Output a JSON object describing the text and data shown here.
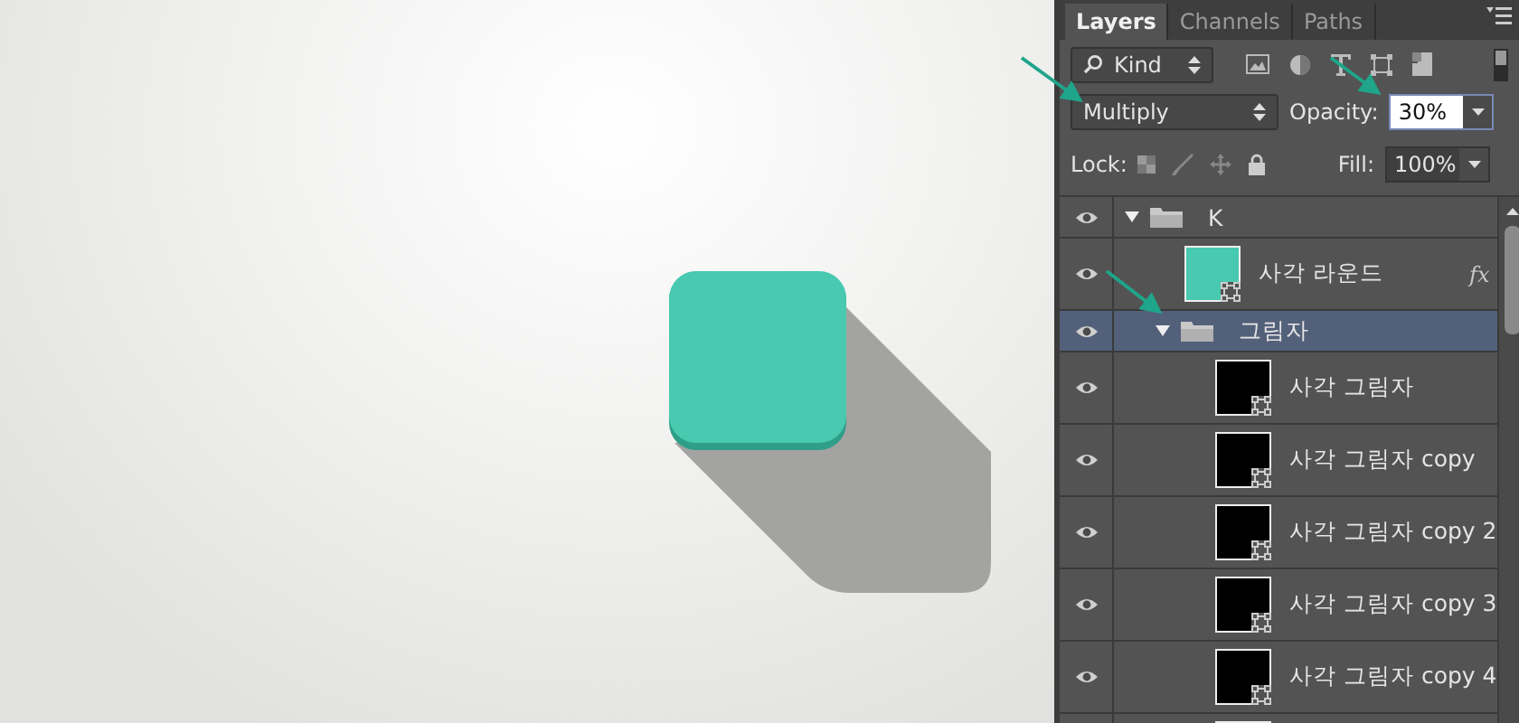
{
  "panel": {
    "tabs": [
      {
        "label": "Layers",
        "selected": true
      },
      {
        "label": "Channels",
        "selected": false
      },
      {
        "label": "Paths",
        "selected": false
      }
    ],
    "filter": {
      "value": "Kind"
    },
    "blend_mode": {
      "value": "Multiply"
    },
    "opacity": {
      "label": "Opacity:",
      "value": "30%"
    },
    "lock": {
      "label": "Lock:"
    },
    "fill": {
      "label": "Fill:",
      "value": "100%"
    },
    "layers": [
      {
        "name": "K",
        "kind": "group",
        "expanded": true,
        "selected": false,
        "visible": true,
        "children": [
          {
            "name": "사각 라운드",
            "kind": "shape",
            "color": "#48c9b0",
            "effects": "fx",
            "selected": false,
            "visible": true
          },
          {
            "name": "그림자",
            "kind": "group",
            "expanded": true,
            "selected": true,
            "visible": true,
            "children": [
              {
                "name": "사각 그림자",
                "kind": "shape",
                "color": "#000000",
                "selected": false,
                "visible": true
              },
              {
                "name": "사각 그림자 copy",
                "kind": "shape",
                "color": "#000000",
                "selected": false,
                "visible": true
              },
              {
                "name": "사각 그림자 copy 2",
                "kind": "shape",
                "color": "#000000",
                "selected": false,
                "visible": true
              },
              {
                "name": "사각 그림자 copy 3",
                "kind": "shape",
                "color": "#000000",
                "selected": false,
                "visible": true
              },
              {
                "name": "사각 그림자 copy 4",
                "kind": "shape",
                "color": "#000000",
                "selected": false,
                "visible": true
              }
            ]
          }
        ]
      }
    ]
  }
}
